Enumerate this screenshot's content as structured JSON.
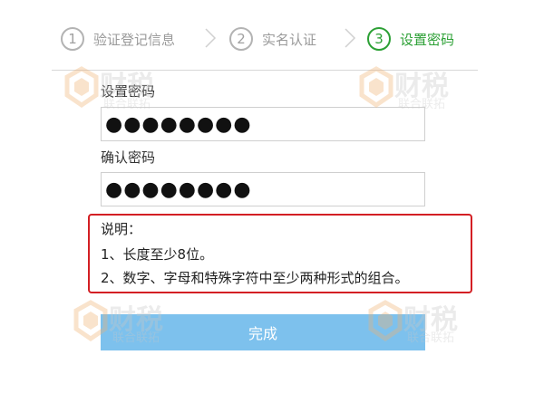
{
  "steps": [
    {
      "number": "1",
      "label": "验证登记信息"
    },
    {
      "number": "2",
      "label": "实名认证"
    },
    {
      "number": "3",
      "label": "设置密码"
    }
  ],
  "form": {
    "password_label": "设置密码",
    "password_value": "●●●●●●●●",
    "confirm_label": "确认密码",
    "confirm_value": "●●●●●●●●"
  },
  "notice": {
    "title": "说明：",
    "line1": "1、长度至少8位。",
    "line2": "2、数字、字母和特殊字符中至少两种形式的组合。"
  },
  "button": {
    "finish_label": "完成"
  },
  "watermark": {
    "brand": "财税",
    "sub": "联合联拓"
  },
  "colors": {
    "active_step": "#2ca035",
    "inactive_step": "#9a9a9a",
    "notice_border": "#d31f24",
    "button_bg": "#7dc1ed"
  }
}
